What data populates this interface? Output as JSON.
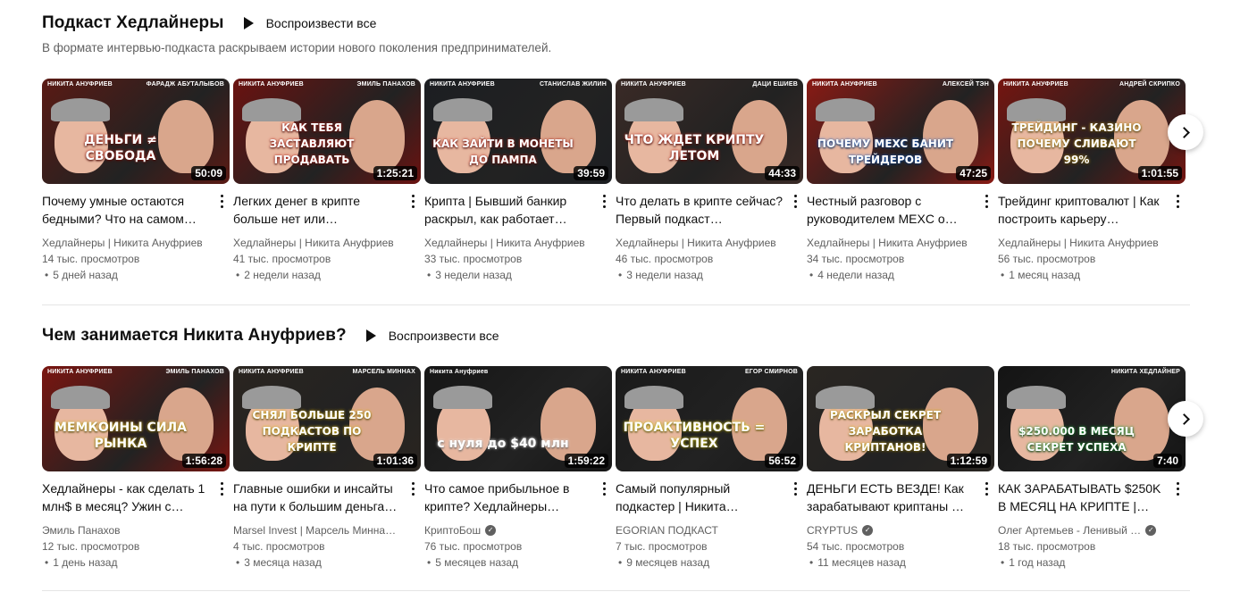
{
  "shelves": [
    {
      "title": "Подкаст Хедлайнеры",
      "play_all": "Воспроизвести все",
      "description": "В формате интервью-подкаста раскрываем истории нового поколения предпринимателей.",
      "videos": [
        {
          "title": "Почему умные остаются бедными? Что на самом…",
          "channel": "Хедлайнеры | Никита Ануфриев",
          "views": "14 тыс. просмотров",
          "age": "5 дней назад",
          "duration": "50:09",
          "thumb_text": "ДЕНЬГИ ≠ СВОБОДА",
          "tag_left": "НИКИТА АНУФРИЕВ",
          "tag_right": "ФАРАДЖ АБУТАЛЫБОВ",
          "bg": "#5a1a14",
          "accent": "#c8291f",
          "verified": false
        },
        {
          "title": "Легких денег в крипте больше нет или…",
          "channel": "Хедлайнеры | Никита Ануфриев",
          "views": "41 тыс. просмотров",
          "age": "2 недели назад",
          "duration": "1:25:21",
          "thumb_text": "КАК ТЕБЯ ЗАСТАВЛЯЮТ ПРОДАВАТЬ",
          "tag_left": "НИКИТА АНУФРИЕВ",
          "tag_right": "ЭМИЛЬ ПАНАХОВ",
          "bg": "#6b1210",
          "accent": "#d1261c",
          "verified": false
        },
        {
          "title": "Крипта | Бывший банкир раскрыл, как работает…",
          "channel": "Хедлайнеры | Никита Ануфриев",
          "views": "33 тыс. просмотров",
          "age": "3 недели назад",
          "duration": "39:59",
          "thumb_text": "КАК ЗАЙТИ В МОНЕТЫ ДО ПАМПА",
          "tag_left": "НИКИТА АНУФРИЕВ",
          "tag_right": "СТАНИСЛАВ ЖИЛИН",
          "bg": "#1c1e22",
          "accent": "#c72a20",
          "verified": false
        },
        {
          "title": "Что делать в крипте сейчас? Первый подкаст…",
          "channel": "Хедлайнеры | Никита Ануфриев",
          "views": "46 тыс. просмотров",
          "age": "3 недели назад",
          "duration": "44:33",
          "thumb_text": "ЧТО ЖДЕТ КРИПТУ ЛЕТОМ",
          "tag_left": "НИКИТА АНУФРИЕВ",
          "tag_right": "ДАЦИ ЕШИЕВ",
          "bg": "#3a2a26",
          "accent": "#c9281e",
          "verified": false
        },
        {
          "title": "Честный разговор с руководителем MEXC о…",
          "channel": "Хедлайнеры | Никита Ануфриев",
          "views": "34 тыс. просмотров",
          "age": "4 недели назад",
          "duration": "47:25",
          "thumb_text": "ПОЧЕМУ MEXC БАНИТ ТРЕЙДЕРОВ",
          "tag_left": "НИКИТА АНУФРИЕВ",
          "tag_right": "АЛЕКСЕЙ ТЭН",
          "bg": "#8a1a14",
          "accent": "#1f6ad8",
          "verified": false
        },
        {
          "title": "Трейдинг криптовалют | Как построить карьеру…",
          "channel": "Хедлайнеры | Никита Ануфриев",
          "views": "56 тыс. просмотров",
          "age": "1 месяц назад",
          "duration": "1:01:55",
          "thumb_text": "ТРЕЙДИНГ - КАЗИНО ПОЧЕМУ СЛИВАЮТ 99%",
          "tag_left": "НИКИТА АНУФРИЕВ",
          "tag_right": "АНДРЕЙ СКРИПКО",
          "bg": "#761510",
          "accent": "#d3a51e",
          "verified": false
        }
      ]
    },
    {
      "title": "Чем занимается Никита Ануфриев?",
      "play_all": "Воспроизвести все",
      "description": "",
      "videos": [
        {
          "title": "Хедлайнеры - как сделать 1 млн$ в месяц? Ужин с…",
          "channel": "Эмиль Панахов",
          "views": "12 тыс. просмотров",
          "age": "1 день назад",
          "duration": "1:56:28",
          "thumb_text": "МЕМКОИНЫ СИЛА РЫНКА",
          "tag_left": "НИКИТА АНУФРИЕВ",
          "tag_right": "ЭМИЛЬ ПАНАХОВ",
          "bg": "#7a1510",
          "accent": "#e3c21c",
          "verified": false
        },
        {
          "title": "Главные ошибки и инсайты на пути к большим деньга…",
          "channel": "Marsel Invest | Марсель Миннах…",
          "views": "4 тыс. просмотров",
          "age": "3 месяца назад",
          "duration": "1:01:36",
          "thumb_text": "СНЯЛ БОЛЬШЕ 250 ПОДКАСТОВ ПО КРИПТЕ",
          "tag_left": "НИКИТА АНУФРИЕВ",
          "tag_right": "МАРСЕЛЬ МИННАХ",
          "bg": "#2a2520",
          "accent": "#f2c81c",
          "verified": false
        },
        {
          "title": "Что самое прибыльное в крипте? Хедлайнеры…",
          "channel": "КриптоБош",
          "views": "76 тыс. просмотров",
          "age": "5 месяцев назад",
          "duration": "1:59:22",
          "thumb_text": "с нуля до $40 млн",
          "tag_left": "Никита Ануфриев",
          "tag_right": "",
          "bg": "#161616",
          "accent": "#ffffff",
          "verified": true
        },
        {
          "title": "Самый популярный подкастер | Никита…",
          "channel": "EGORIAN ПОДКАСТ",
          "views": "7 тыс. просмотров",
          "age": "9 месяцев назад",
          "duration": "56:52",
          "thumb_text": "ПРОАКТИВНОСТЬ = УСПЕХ",
          "tag_left": "НИКИТА АНУФРИЕВ",
          "tag_right": "ЕГОР СМИРНОВ",
          "bg": "#1a1a1a",
          "accent": "#f0e21c",
          "verified": false
        },
        {
          "title": "ДЕНЬГИ ЕСТЬ ВЕЗДЕ! Как зарабатывают криптаны …",
          "channel": "CRYPTUS",
          "views": "54 тыс. просмотров",
          "age": "11 месяцев назад",
          "duration": "1:12:59",
          "thumb_text": "РАСКРЫЛ СЕКРЕТ ЗАРАБОТКА КРИПТАНОВ!",
          "tag_left": "",
          "tag_right": "",
          "bg": "#2a2622",
          "accent": "#e8c21c",
          "verified": true
        },
        {
          "title": "КАК ЗАРАБАТЫВАТЬ $250K В МЕСЯЦ НА КРИПТЕ |…",
          "channel": "Олег Артемьев - Ленивый …",
          "views": "18 тыс. просмотров",
          "age": "1 год назад",
          "duration": "7:40",
          "thumb_text": "$250.000 В МЕСЯЦ СЕКРЕТ УСПЕХА",
          "tag_left": "",
          "tag_right": "НИКИТА ХЕДЛАЙНЕР",
          "bg": "#141414",
          "accent": "#1fae3a",
          "verified": true
        }
      ]
    }
  ],
  "icons": {
    "play": "play-icon",
    "more": "more-vert-icon",
    "next": "chevron-right-icon",
    "verified": "verified-check-icon"
  }
}
